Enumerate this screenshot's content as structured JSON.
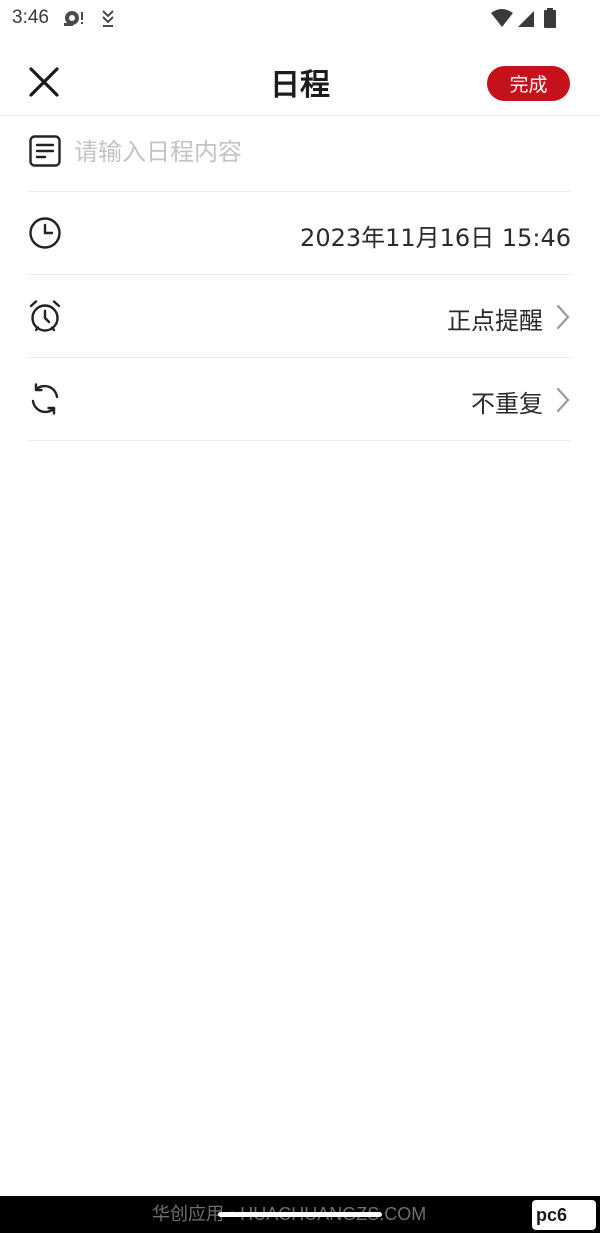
{
  "status_bar": {
    "time": "3:46",
    "icons": [
      "notification-icon",
      "download-icon",
      "wifi-icon",
      "cell-signal-icon",
      "battery-icon"
    ]
  },
  "header": {
    "title": "日程",
    "close_icon": "close-icon",
    "done_label": "完成",
    "accent_color": "#c4111b"
  },
  "form": {
    "content": {
      "icon": "note-icon",
      "placeholder": "请输入日程内容",
      "value": ""
    },
    "datetime": {
      "icon": "clock-icon",
      "value": "2023年11月16日 15:46"
    },
    "reminder": {
      "icon": "alarm-clock-icon",
      "value": "正点提醒"
    },
    "repeat": {
      "icon": "repeat-icon",
      "value": "不重复"
    }
  },
  "footer": {
    "watermark": "华创应用 • HUACHUANGZS.COM",
    "logo_text": "pc6"
  }
}
